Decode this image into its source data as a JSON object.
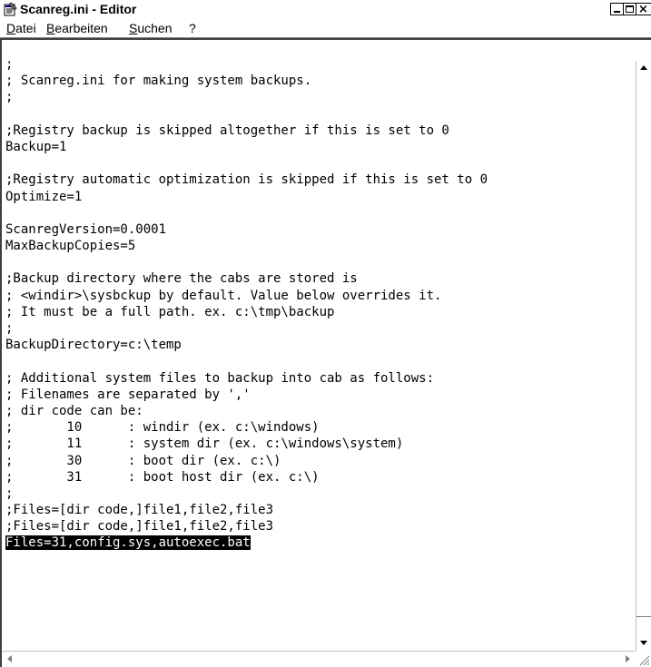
{
  "window": {
    "title": "Scanreg.ini - Editor",
    "icon": "notepad-icon",
    "buttons": {
      "minimize": "minimize-icon",
      "maximize": "maximize-icon",
      "close": "close-icon"
    }
  },
  "menu": {
    "items": [
      "Datei",
      "Bearbeiten",
      "Suchen",
      "?"
    ]
  },
  "editor": {
    "lines": [
      ";",
      "; Scanreg.ini for making system backups.",
      ";",
      "",
      ";Registry backup is skipped altogether if this is set to 0",
      "Backup=1",
      "",
      ";Registry automatic optimization is skipped if this is set to 0",
      "Optimize=1",
      "",
      "ScanregVersion=0.0001",
      "MaxBackupCopies=5",
      "",
      ";Backup directory where the cabs are stored is",
      "; <windir>\\sysbckup by default. Value below overrides it.",
      "; It must be a full path. ex. c:\\tmp\\backup",
      ";",
      "BackupDirectory=c:\\temp",
      "",
      "; Additional system files to backup into cab as follows:",
      "; Filenames are separated by ','",
      "; dir code can be:",
      ";       10      : windir (ex. c:\\windows)",
      ";       11      : system dir (ex. c:\\windows\\system)",
      ";       30      : boot dir (ex. c:\\)",
      ";       31      : boot host dir (ex. c:\\)",
      ";",
      ";Files=[dir code,]file1,file2,file3",
      ";Files=[dir code,]file1,file2,file3",
      "Files=31,config.sys,autoexec.bat"
    ],
    "selected_line_index": 29
  },
  "scrollbars": {
    "vertical": {
      "up": "scroll-up-arrow-icon",
      "down": "scroll-down-arrow-icon"
    },
    "horizontal": {
      "left": "scroll-left-arrow-icon",
      "right": "scroll-right-arrow-icon"
    }
  }
}
